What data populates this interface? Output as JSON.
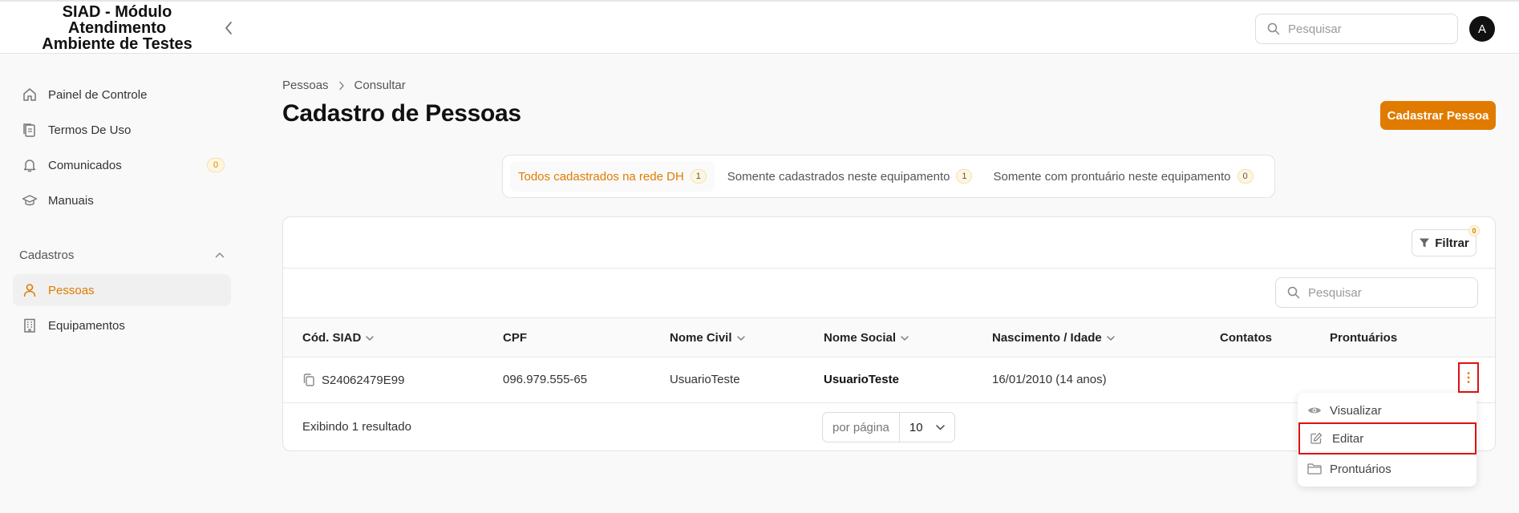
{
  "app": {
    "title": "SIAD - Módulo Atendimento Ambiente de Testes"
  },
  "header": {
    "search_placeholder": "Pesquisar",
    "avatar_initial": "A"
  },
  "sidebar": {
    "items": [
      {
        "label": "Painel de Controle",
        "icon": "home-icon"
      },
      {
        "label": "Termos De Uso",
        "icon": "documents-icon"
      },
      {
        "label": "Comunicados",
        "icon": "bell-icon",
        "badge": "0"
      },
      {
        "label": "Manuais",
        "icon": "graduation-cap-icon"
      }
    ],
    "section": {
      "title": "Cadastros",
      "items": [
        {
          "label": "Pessoas",
          "icon": "user-icon",
          "active": true
        },
        {
          "label": "Equipamentos",
          "icon": "building-icon"
        }
      ]
    }
  },
  "breadcrumb": [
    "Pessoas",
    "Consultar"
  ],
  "page": {
    "title": "Cadastro de Pessoas",
    "primary_button": "Cadastrar Pessoa"
  },
  "tabs": [
    {
      "label": "Todos cadastrados na rede DH",
      "count": "1",
      "active": true
    },
    {
      "label": "Somente cadastrados neste equipamento",
      "count": "1"
    },
    {
      "label": "Somente com prontuário neste equipamento",
      "count": "0"
    }
  ],
  "toolbar": {
    "filter_label": "Filtrar",
    "filter_count": "0",
    "search_placeholder": "Pesquisar"
  },
  "table": {
    "columns": [
      "Cód. SIAD",
      "CPF",
      "Nome Civil",
      "Nome Social",
      "Nascimento / Idade",
      "Contatos",
      "Prontuários"
    ],
    "rows": [
      {
        "cod": "S24062479E99",
        "cpf": "096.979.555-65",
        "nome_civil": "UsuarioTeste",
        "nome_social": "UsuarioTeste",
        "nascimento": "16/01/2010 (14 anos)",
        "contatos": "",
        "prontuarios": ""
      }
    ]
  },
  "footer": {
    "result_text": "Exibindo 1 resultado",
    "per_page_label": "por página",
    "per_page_value": "10"
  },
  "row_menu": {
    "items": [
      "Visualizar",
      "Editar",
      "Prontuários"
    ]
  },
  "colors": {
    "accent": "#e07b00",
    "highlight_border": "#e01010"
  }
}
